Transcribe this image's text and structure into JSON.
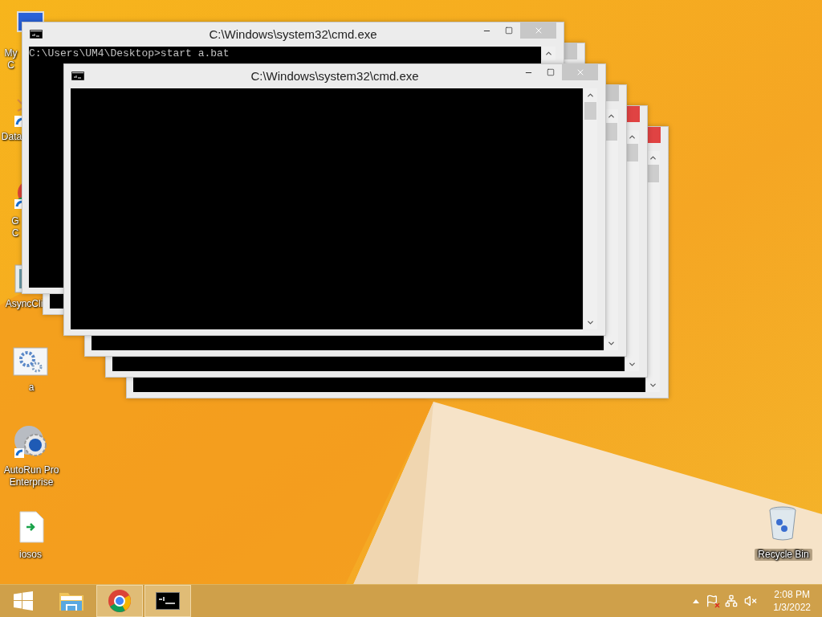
{
  "desktop_icons": [
    {
      "kind": "computer",
      "label": "My C"
    },
    {
      "kind": "database",
      "label": "Data"
    },
    {
      "kind": "chrome",
      "label": "G C"
    },
    {
      "kind": "app",
      "label": "AsyncCli"
    },
    {
      "kind": "gears",
      "label": "a"
    },
    {
      "kind": "disc",
      "label": "AutoRun Pro Enterprise"
    },
    {
      "kind": "document",
      "label": "iosos"
    },
    {
      "kind": "recycle",
      "label": "Recycle Bin"
    }
  ],
  "windows": [
    {
      "title": "C:\\Windows\\system32\\cmd.exe",
      "console_text": "C:\\Users\\UM4\\Desktop>start a.bat",
      "close_highlighted": false
    },
    {
      "close_highlighted": false
    },
    {
      "title": "C:\\Windows\\system32\\cmd.exe",
      "close_highlighted": false
    },
    {
      "close_highlighted": false
    },
    {
      "close_highlighted": true
    },
    {
      "close_highlighted": true
    }
  ],
  "taskbar": {
    "apps": [
      {
        "kind": "start",
        "running": false
      },
      {
        "kind": "explorer",
        "running": false
      },
      {
        "kind": "chrome",
        "running": true
      },
      {
        "kind": "console",
        "running": true
      }
    ],
    "tray": {
      "time": "2:08 PM",
      "date": "1/3/2022"
    }
  }
}
